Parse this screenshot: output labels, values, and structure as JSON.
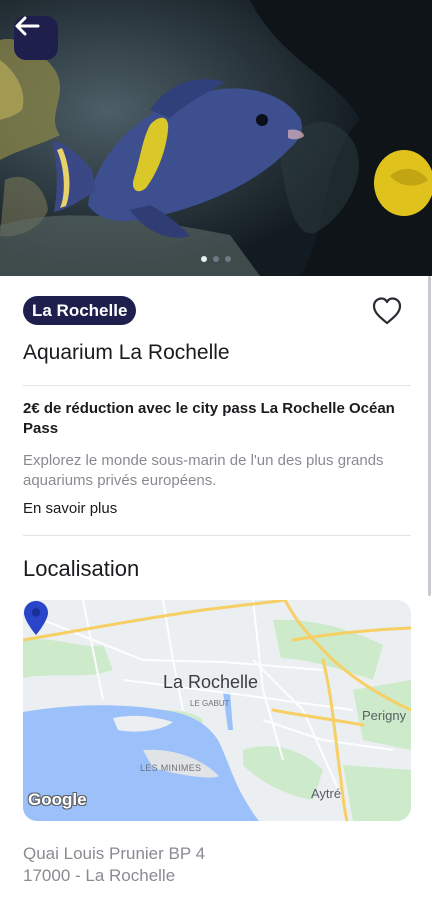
{
  "hero": {
    "slide_count": 3,
    "active_slide": 1
  },
  "badge": {
    "label": "La Rochelle"
  },
  "title": "Aquarium La Rochelle",
  "promo": "2€ de réduction avec le city pass La Rochelle Océan Pass",
  "description": "Explorez le monde sous-marin de l'un des plus grands aquariums privés européens.",
  "more_label": "En savoir plus",
  "location": {
    "heading": "Localisation",
    "map": {
      "city_label": "La Rochelle",
      "district_1": "LE GABUT",
      "district_2": "LES MINIMES",
      "town_1": "Perigny",
      "town_2": "Aytré",
      "attribution": "Google"
    },
    "address_line1": "Quai Louis Prunier BP 4",
    "address_line2": "17000 - La Rochelle"
  },
  "colors": {
    "brand_navy": "#1f1f4d",
    "pin_blue": "#2a45c8",
    "water": "#9cc0f9",
    "park": "#cdeacb",
    "road": "#f6cf65"
  },
  "icons": {
    "back": "arrow-left-icon",
    "favorite": "heart-outline-icon",
    "map_pin": "map-pin-icon"
  }
}
